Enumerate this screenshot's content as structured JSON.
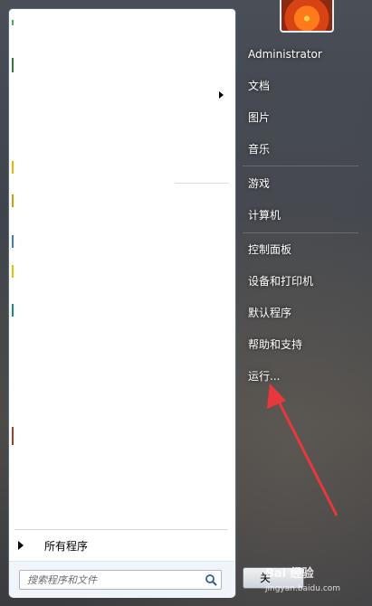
{
  "start_menu": {
    "all_programs_label": "所有程序",
    "search": {
      "placeholder": "搜索程序和文件"
    },
    "shutdown_label": "关"
  },
  "user": {
    "name": "Administrator"
  },
  "right_pane": {
    "items": [
      {
        "label": "Administrator"
      },
      {
        "label": "文档"
      },
      {
        "label": "图片"
      },
      {
        "label": "音乐"
      },
      {
        "label": "游戏"
      },
      {
        "label": "计算机"
      },
      {
        "label": "控制面板"
      },
      {
        "label": "设备和打印机"
      },
      {
        "label": "默认程序"
      },
      {
        "label": "帮助和支持"
      },
      {
        "label": "运行..."
      }
    ]
  },
  "watermark": {
    "logo": "Bai 经验",
    "url": "jingyan.baidu.com"
  },
  "annotation": {
    "color": "#e8383d"
  },
  "icons": [
    "search-icon",
    "submenu-arrow-icon",
    "all-programs-arrow-icon",
    "user-picture-flower-icon"
  ]
}
